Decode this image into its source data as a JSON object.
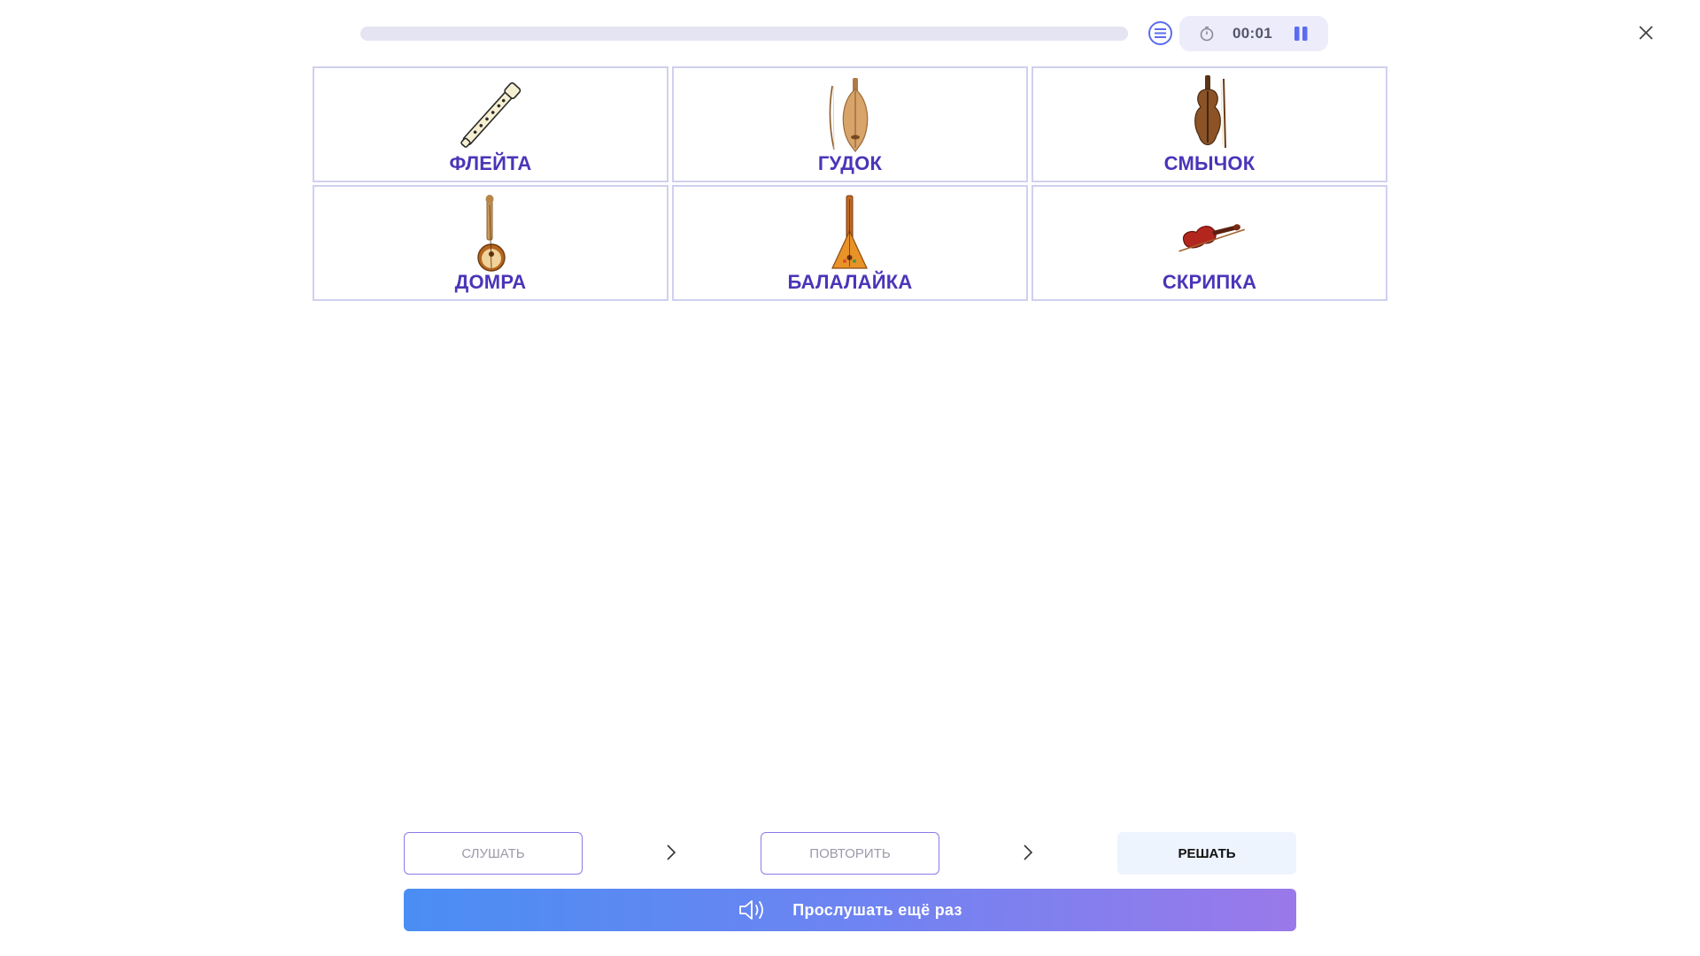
{
  "header": {
    "progress_fraction": 0,
    "timer": "00:01",
    "icons": {
      "task_list": "list-icon",
      "timer": "stopwatch-icon",
      "pause": "pause-icon",
      "close": "close-icon"
    },
    "colors": {
      "accent": "#5b6cf0",
      "track": "#e4e4f2",
      "timer_bg": "#ececfb"
    }
  },
  "cards": [
    {
      "label": "ФЛЕЙТА",
      "image": "flute"
    },
    {
      "label": "ГУДОК",
      "image": "gudok"
    },
    {
      "label": "СМЫЧОК",
      "image": "violin-with-bow"
    },
    {
      "label": "ДОМРА",
      "image": "domra"
    },
    {
      "label": "БАЛАЛАЙКА",
      "image": "balalaika"
    },
    {
      "label": "СКРИПКА",
      "image": "violin"
    }
  ],
  "steps": {
    "listen": "СЛУШАТЬ",
    "repeat": "ПОВТОРИТЬ",
    "solve": "РЕШАТЬ"
  },
  "listen_again": {
    "label": "Прослушать ещё раз",
    "icon": "speaker-icon"
  },
  "colors": {
    "card_label": "#4a35b8",
    "card_border": "#cfd0ee",
    "gradient_start": "#4a8ef3",
    "gradient_end": "#9a79ea"
  }
}
